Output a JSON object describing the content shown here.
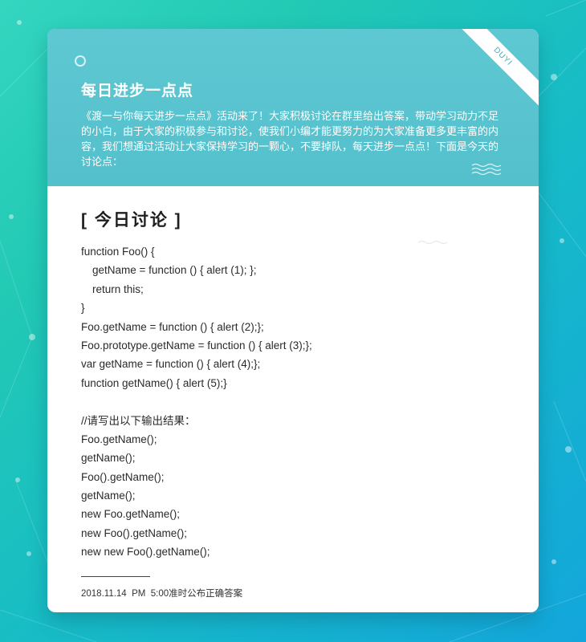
{
  "header": {
    "title": "每日进步一点点",
    "description": "《渡一与你每天进步一点点》活动来了！大家积极讨论在群里给出答案，带动学习动力不足的小白，由于大家的积极参与和讨论，使我们小编才能更努力的为大家准备更多更丰富的内容，我们想通过活动让大家保持学习的一颗心，不要掉队，每天进步一点点！下面是今天的讨论点：",
    "ribbon_text": "DUYI"
  },
  "section": {
    "heading": "[ 今日讨论 ]"
  },
  "code": {
    "lines": [
      "function Foo() {",
      "getName = function () { alert (1); };",
      "return this;",
      "}",
      "Foo.getName = function () { alert (2);};",
      "Foo.prototype.getName = function () { alert (3);};",
      "var getName = function () { alert (4);};",
      "function getName() { alert (5);}",
      "",
      "//请写出以下输出结果：",
      "Foo.getName();",
      "getName();",
      "Foo().getName();",
      "getName();",
      "new Foo.getName();",
      "new Foo().getName();",
      "new new Foo().getName();"
    ]
  },
  "footer": {
    "note": "2018.11.14  PM  5:00准时公布正确答案"
  },
  "icons": {
    "header_dot": "circle-icon",
    "wave": "wave-icon"
  },
  "colors": {
    "background_start": "#34d6c0",
    "background_end": "#13a6dc",
    "header_bg": "#5ec8d2",
    "card_bg": "#ffffff"
  }
}
